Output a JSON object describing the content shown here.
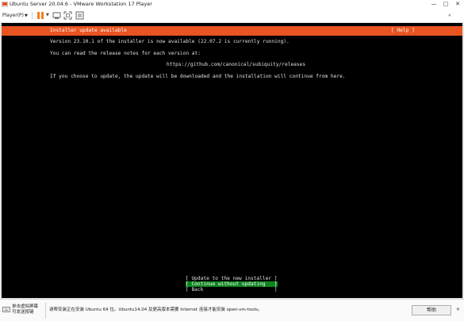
{
  "window": {
    "title": "Ubuntu Server 20.04.6 - VMware Workstation 17 Player",
    "minimize": "—",
    "maximize": "□",
    "close": "✕"
  },
  "toolbar": {
    "player_label": "Player(P)",
    "player_caret": "▼",
    "pause_caret": "▼",
    "right_label": "«"
  },
  "installer": {
    "header_title": "Installer update available",
    "help_label": "[ Help ]",
    "lines": [
      "Version 23.10.1 of the installer is now available (22.07.2 is currently running).",
      "You can read the release notes for each version at:",
      "https://github.com/canonical/subiquity/releases",
      "If you choose to update, the update will be downloaded and the installation will continue from here."
    ],
    "options": [
      "[ Update to the new installer ]",
      "[ Continue without updating   ]",
      "[ Back                        ]"
    ],
    "selected_option_index": 1,
    "accent_color": "#e95420",
    "selected_color": "#0e8420"
  },
  "infobar": {
    "left_line1": "单击虚拟屏幕",
    "left_line2": "可发送按键",
    "message": "请帮安装正在安装 Ubuntu 64 位。Ubuntu14.04 及更高版本需要 Internet 连接才能安装 open-vm-tools。",
    "help_button": "帮助",
    "close": "✕"
  }
}
